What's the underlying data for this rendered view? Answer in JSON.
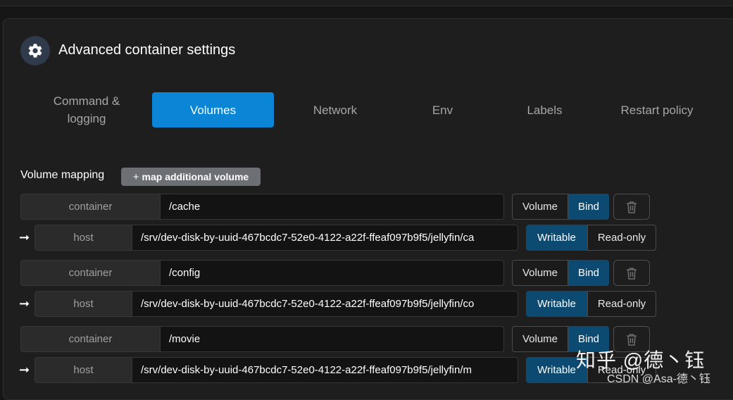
{
  "header": {
    "title": "Advanced container settings",
    "icon": "gear-icon"
  },
  "tabs": [
    {
      "label": "Command &\nlogging",
      "active": false
    },
    {
      "label": "Volumes",
      "active": true
    },
    {
      "label": "Network",
      "active": false
    },
    {
      "label": "Env",
      "active": false
    },
    {
      "label": "Labels",
      "active": false
    },
    {
      "label": "Restart policy",
      "active": false
    }
  ],
  "volume_mapping": {
    "label": "Volume mapping",
    "add_plus": "+",
    "add_label": "map additional volume",
    "container_prefix": "container",
    "host_prefix": "host",
    "type_volume": "Volume",
    "type_bind": "Bind",
    "mode_writable": "Writable",
    "mode_readonly": "Read-only",
    "arrow": "➞",
    "mappings": [
      {
        "container": "/cache",
        "host": "/srv/dev-disk-by-uuid-467bcdc7-52e0-4122-a22f-ffeaf097b9f5/jellyfin/ca",
        "type": "Bind",
        "mode": "Writable"
      },
      {
        "container": "/config",
        "host": "/srv/dev-disk-by-uuid-467bcdc7-52e0-4122-a22f-ffeaf097b9f5/jellyfin/co",
        "type": "Bind",
        "mode": "Writable"
      },
      {
        "container": "/movie",
        "host": "/srv/dev-disk-by-uuid-467bcdc7-52e0-4122-a22f-ffeaf097b9f5/jellyfin/m",
        "type": "Bind",
        "mode": "Writable"
      }
    ]
  },
  "watermark": {
    "line1": "知乎 @德丶钰",
    "line2": "CSDN @Asa-德丶钰"
  },
  "colors": {
    "accent": "#0b86d6",
    "selected_segment": "#0d4a72",
    "background": "#161616",
    "panel": "#1e1e1e"
  }
}
